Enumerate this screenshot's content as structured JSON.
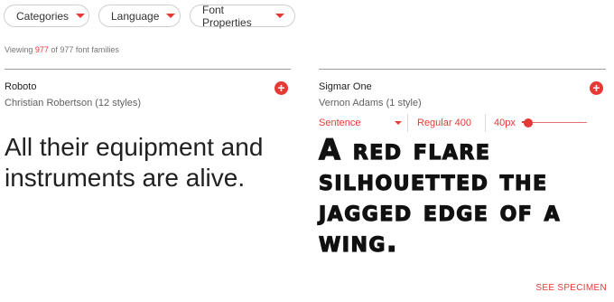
{
  "filters": [
    {
      "label": "Categories"
    },
    {
      "label": "Language"
    },
    {
      "label": "Font Properties"
    }
  ],
  "viewing": {
    "prefix": "Viewing ",
    "count": "977",
    "suffix": " of 977 font families"
  },
  "cards": [
    {
      "font_name": "Roboto",
      "designer": "Christian Robertson (12 styles)",
      "sample": "All their equipment and instruments are alive.",
      "add_label": "+"
    },
    {
      "font_name": "Sigmar One",
      "designer": "Vernon Adams (1 style)",
      "sample": "A red flare silhouetted the jagged edge of a wing.",
      "add_label": "+",
      "controls": {
        "case": "Sentence",
        "weight": "Regular 400",
        "size": "40px",
        "slider_fraction": 0.1
      }
    }
  ],
  "see_specimen": "SEE SPECIMEN",
  "colors": {
    "accent": "#e53935"
  },
  "icons": {
    "add": "plus-circle-icon",
    "dropdown": "caret-down-icon"
  }
}
